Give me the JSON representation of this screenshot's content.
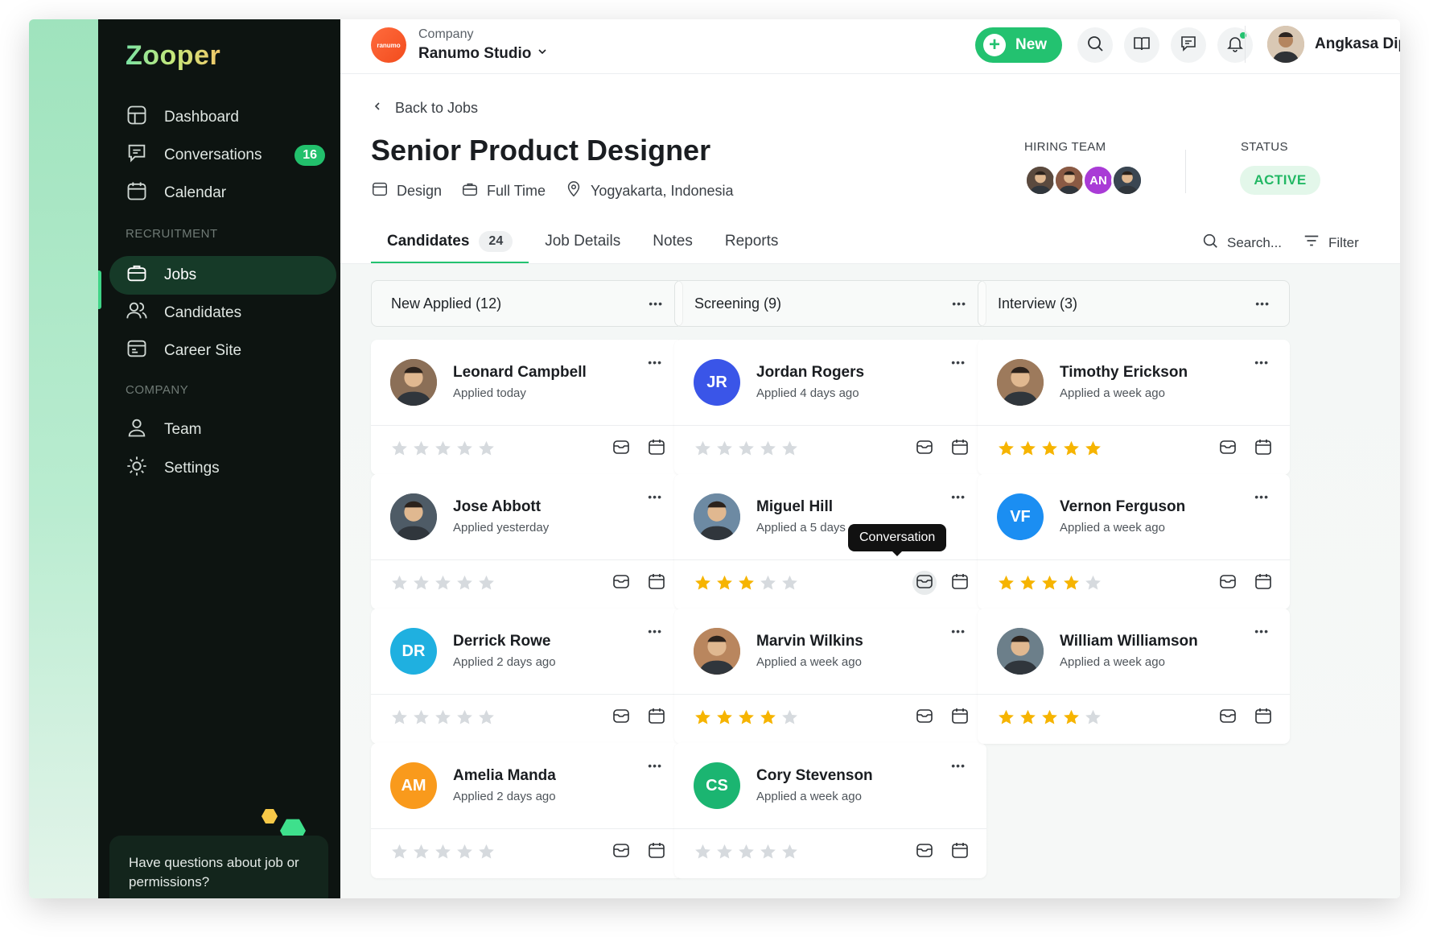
{
  "app": {
    "name": "Zooper"
  },
  "sidebar": {
    "items": [
      {
        "label": "Dashboard",
        "icon": "dashboard-icon"
      },
      {
        "label": "Conversations",
        "icon": "chat-icon",
        "badge": "16"
      },
      {
        "label": "Calendar",
        "icon": "calendar-icon"
      }
    ],
    "recruitment_label": "RECRUITMENT",
    "recruitment": [
      {
        "label": "Jobs",
        "icon": "briefcase-icon",
        "active": true
      },
      {
        "label": "Candidates",
        "icon": "users-icon"
      },
      {
        "label": "Career Site",
        "icon": "career-site-icon"
      }
    ],
    "company_label": "COMPANY",
    "company": [
      {
        "label": "Team",
        "icon": "user-icon"
      },
      {
        "label": "Settings",
        "icon": "gear-icon"
      }
    ],
    "help": "Have questions about job or permissions?"
  },
  "topbar": {
    "company_caption": "Company",
    "company_name": "Ranumo Studio",
    "company_logo_text": "ranumo",
    "new_label": "New",
    "user_name": "Angkasa Dipta"
  },
  "job": {
    "back_label": "Back to Jobs",
    "title": "Senior Product Designer",
    "department": "Design",
    "type": "Full Time",
    "location": "Yogyakarta, Indonesia",
    "hiring_label": "HIRING TEAM",
    "hiring_team": [
      {
        "initials": "",
        "color": "#5b4a3e"
      },
      {
        "initials": "",
        "color": "#8a5a44"
      },
      {
        "initials": "AN",
        "color": "#a93bd6"
      },
      {
        "initials": "",
        "color": "#3a4652"
      }
    ],
    "status_label": "STATUS",
    "status": "ACTIVE"
  },
  "tabs": [
    {
      "label": "Candidates",
      "count": "24",
      "active": true
    },
    {
      "label": "Job Details"
    },
    {
      "label": "Notes"
    },
    {
      "label": "Reports"
    }
  ],
  "toolbar": {
    "search": "Search...",
    "filter": "Filter"
  },
  "columns": [
    {
      "title": "New Applied (12)",
      "cards": [
        {
          "name": "Leonard Campbell",
          "applied": "Applied today",
          "rating": 0,
          "initials": "",
          "color": "#8b6f57"
        },
        {
          "name": "Jose Abbott",
          "applied": "Applied yesterday",
          "rating": 0,
          "initials": "",
          "color": "#4e5b66"
        },
        {
          "name": "Derrick Rowe",
          "applied": "Applied 2 days ago",
          "rating": 0,
          "initials": "DR",
          "color": "#1fb0e0"
        },
        {
          "name": "Amelia Manda",
          "applied": "Applied 2 days ago",
          "rating": 0,
          "initials": "AM",
          "color": "#f99a1c"
        }
      ]
    },
    {
      "title": "Screening (9)",
      "cards": [
        {
          "name": "Jordan Rogers",
          "applied": "Applied 4 days ago",
          "rating": 0,
          "initials": "JR",
          "color": "#3a55e8"
        },
        {
          "name": "Miguel Hill",
          "applied": "Applied a 5 days ago",
          "rating": 3,
          "initials": "",
          "color": "#6d8aa3",
          "tooltip": "Conversation"
        },
        {
          "name": "Marvin Wilkins",
          "applied": "Applied a week ago",
          "rating": 4,
          "initials": "",
          "color": "#b9865e"
        },
        {
          "name": "Cory Stevenson",
          "applied": "Applied a week ago",
          "rating": 0,
          "initials": "CS",
          "color": "#1bb571"
        }
      ]
    },
    {
      "title": "Interview (3)",
      "cards": [
        {
          "name": "Timothy Erickson",
          "applied": "Applied a week ago",
          "rating": 5,
          "initials": "",
          "color": "#9d7a5c"
        },
        {
          "name": "Vernon Ferguson",
          "applied": "Applied a week ago",
          "rating": 4,
          "initials": "VF",
          "color": "#1b8ef2"
        },
        {
          "name": "William Williamson",
          "applied": "Applied a week ago",
          "rating": 4,
          "initials": "",
          "color": "#6c7f8a"
        }
      ]
    }
  ],
  "colors": {
    "accent": "#23c270",
    "star_on": "#f6b400",
    "star_off": "#d6dade"
  }
}
